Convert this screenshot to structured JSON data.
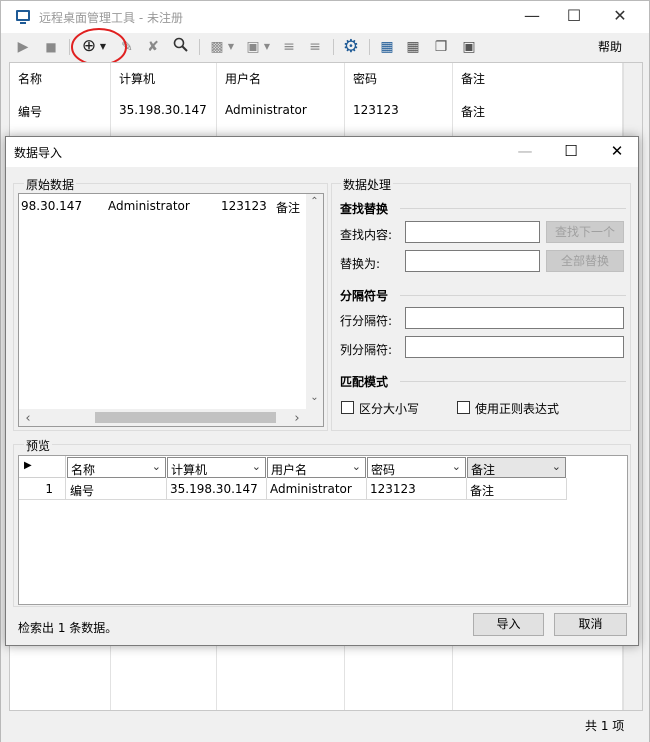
{
  "main": {
    "title": "远程桌面管理工具 - 未注册",
    "help_label": "帮助",
    "columns": [
      "名称",
      "计算机",
      "用户名",
      "密码",
      "备注"
    ],
    "row": [
      "编号",
      "35.198.30.147",
      "Administrator",
      "123123",
      "备注"
    ],
    "status": "共 1 项",
    "toolbar_icons": [
      "play-icon",
      "stop-icon",
      "add-icon",
      "dropdown-icon",
      "edit-icon",
      "delete-icon",
      "search-icon",
      "paste-icon",
      "dropdown-icon",
      "import-icon",
      "dropdown-icon",
      "align-up-icon",
      "align-down-icon",
      "settings-icon",
      "fullscreen-icon",
      "tile-icon",
      "cascade-icon",
      "window-icon"
    ]
  },
  "dialog": {
    "title": "数据导入",
    "raw_group": "原始数据",
    "raw_row": [
      "98.30.147",
      "Administrator",
      "123123",
      "备注"
    ],
    "proc_group": "数据处理",
    "find_replace": "查找替换",
    "find_label": "查找内容:",
    "find_value": "",
    "replace_label": "替换为:",
    "replace_value": "",
    "find_next": "查找下一个",
    "replace_all": "全部替换",
    "sep_title": "分隔符号",
    "row_sep_label": "行分隔符:",
    "row_sep_value": "",
    "col_sep_label": "列分隔符:",
    "col_sep_value": "",
    "match_title": "匹配模式",
    "case_label": "区分大小写",
    "case_checked": false,
    "regex_label": "使用正则表达式",
    "regex_checked": false,
    "preview_group": "预览",
    "preview_columns": [
      "名称",
      "计算机",
      "用户名",
      "密码",
      "备注"
    ],
    "preview_row_num": "1",
    "preview_row": [
      "编号",
      "35.198.30.147",
      "Administrator",
      "123123",
      "备注"
    ],
    "status": "检索出 1 条数据。",
    "import_label": "导入",
    "cancel_label": "取消"
  },
  "annotation": {
    "color": "#e02020",
    "shape": "red-circle-highlight"
  }
}
